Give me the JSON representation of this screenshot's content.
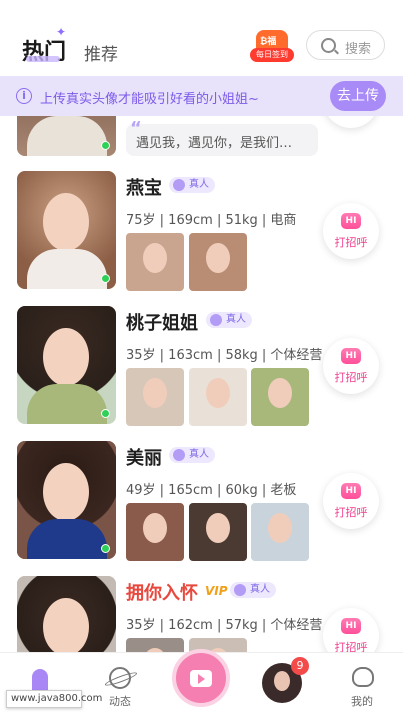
{
  "header": {
    "tab_hot": "热门",
    "tab_recommend": "推荐",
    "checkin_badge": "每日签到",
    "checkin_bag_text": "₿福",
    "search_label": "搜索"
  },
  "banner": {
    "text": "上传真实头像才能吸引好看的小姐姐~",
    "button": "去上传"
  },
  "cards": [
    {
      "quote": "遇见我，遇见你，是我们…",
      "online": true
    },
    {
      "name": "燕宝",
      "badge": "真人",
      "stats": "75岁 | 169cm | 51kg | 电商",
      "online": true,
      "hi": "打招呼"
    },
    {
      "name": "桃子姐姐",
      "badge": "真人",
      "stats": "35岁 | 163cm | 58kg | 个体经营",
      "online": true,
      "hi": "打招呼"
    },
    {
      "name": "美丽",
      "badge": "真人",
      "stats": "49岁 | 165cm | 60kg | 老板",
      "online": true,
      "hi": "打招呼"
    },
    {
      "name": "拥你入怀",
      "vip": "VIP",
      "badge": "真人",
      "stats": "35岁 | 162cm | 57kg | 个体经营",
      "hi": "打招呼"
    }
  ],
  "hi_bubble": "HI",
  "nav": {
    "dynamic": "动态",
    "mine": "我的",
    "message_count": "9"
  },
  "watermark": "www.java800.com"
}
